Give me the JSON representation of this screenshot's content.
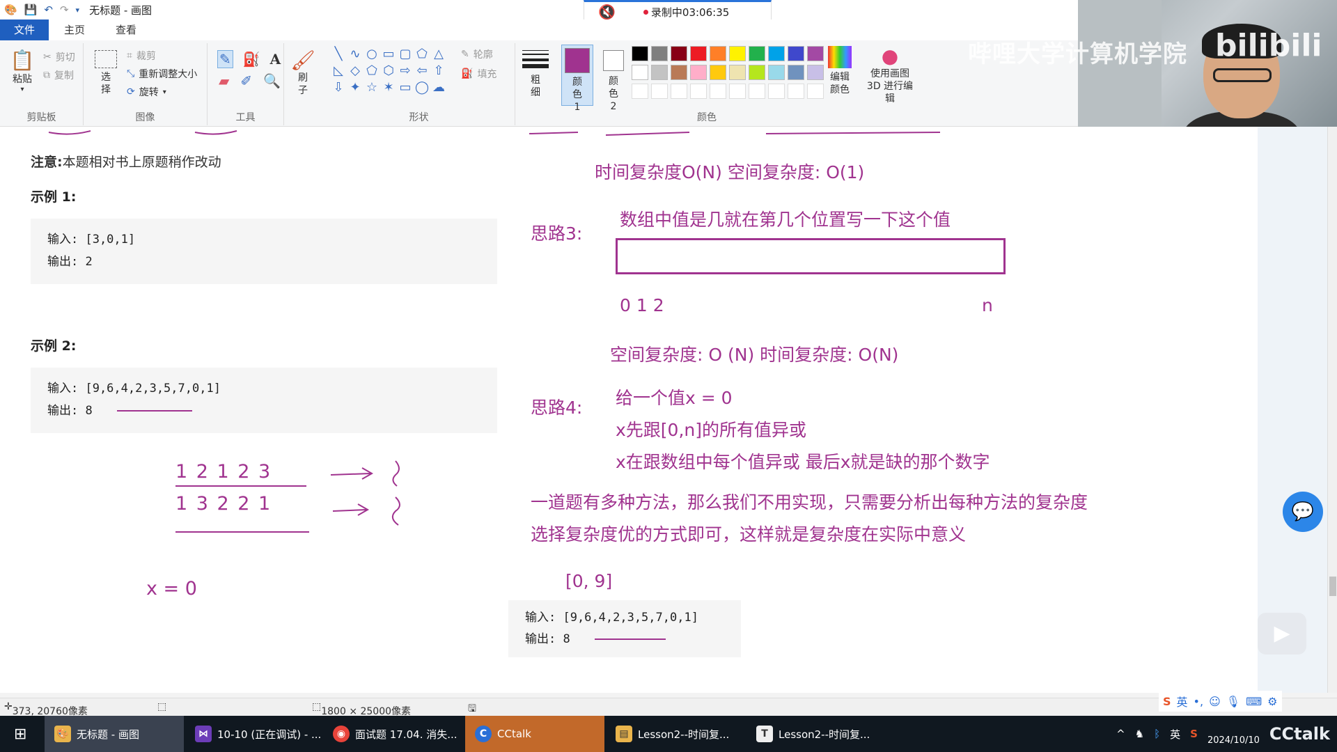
{
  "window": {
    "title": "无标题 - 画图",
    "recording_label": "录制中03:06:35"
  },
  "tabs": [
    "文件",
    "主页",
    "查看"
  ],
  "ribbon": {
    "clipboard": {
      "paste": "粘贴",
      "cut": "剪切",
      "copy": "复制",
      "label": "剪贴板"
    },
    "image": {
      "select": "选择",
      "crop": "裁剪",
      "resize": "重新调整大小",
      "rotate": "旋转",
      "label": "图像"
    },
    "tools": {
      "label": "工具"
    },
    "brushes": {
      "label": "刷子"
    },
    "shapes": {
      "outline": "轮廓",
      "fill": "填充",
      "label": "形状"
    },
    "size": {
      "label": "粗细"
    },
    "color1": "颜色 1",
    "color2": "颜色 2",
    "colors_label": "颜色",
    "edit_colors": "编辑颜色",
    "paint3d": "使用画图 3D 进行编辑",
    "color1_hex": "#a0338f",
    "palette": [
      "#000000",
      "#7f7f7f",
      "#880015",
      "#ed1c24",
      "#ff7f27",
      "#fff200",
      "#22b14c",
      "#00a2e8",
      "#3f48cc",
      "#a349a4",
      "#ffffff",
      "#c3c3c3",
      "#b97a57",
      "#ffaec9",
      "#ffc90e",
      "#efe4b0",
      "#b5e61d",
      "#99d9ea",
      "#7092be",
      "#c8bfe7",
      "#ffffff",
      "#ffffff",
      "#ffffff",
      "#ffffff",
      "#ffffff",
      "#ffffff",
      "#ffffff",
      "#ffffff",
      "#ffffff",
      "#ffffff"
    ]
  },
  "webcam": {
    "watermark": "哔哩大学计算机学院"
  },
  "doc": {
    "note_label": "注意:",
    "note_text": "本题相对书上原题稍作改动",
    "example1_label": "示例 1:",
    "example1_input": "输入: [3,0,1]",
    "example1_output": "输出: 2",
    "example2_label": "示例 2:",
    "example2_input": "输入: [9,6,4,2,3,5,7,0,1]",
    "example2_output": "输出: 8",
    "example3_input": "输入: [9,6,4,2,3,5,7,0,1]",
    "example3_output": "输出: 8"
  },
  "handwriting": {
    "complexity1": "时间复杂度O(N)      空间复杂度: O(1)",
    "idea3_label": "思路3:",
    "idea3_text": "数组中值是几就在第几个位置写一下这个值",
    "indices": "0   1   2",
    "n_label": "n",
    "complexity3": "空间复杂度: O (N)     时间复杂度: O(N)",
    "idea4_label": "思路4:",
    "idea4_line1": "给一个值x = 0",
    "idea4_line2": "x先跟[0,n]的所有值异或",
    "idea4_line3": "x在跟数组中每个值异或     最后x就是缺的那个数字",
    "summary_line1": "一道题有多种方法，那么我们不用实现，只需要分析出每种方法的复杂度",
    "summary_line2": "选择复杂度优的方式即可，这样就是复杂度在实际中意义",
    "range": "[0, 9]",
    "row1": "1  2  1  2  3",
    "row2": "1  3  2  2  1",
    "x_eq": "x = 0"
  },
  "status": {
    "cursor": "373, 20760像素",
    "canvas_size": "1800 × 25000像素"
  },
  "taskbar": {
    "items": [
      "无标题 - 画图",
      "10-10 (正在调试) - ...",
      "面试题 17.04. 消失...",
      "CCtalk",
      "Lesson2--时间复...",
      "Lesson2--时间复..."
    ],
    "ime": "英",
    "date": "2024/10/10",
    "cctalk_brand": "CCtalk"
  },
  "icons": [
    "save-icon",
    "undo-icon",
    "redo-icon",
    "paste-icon",
    "cut-icon",
    "copy-icon",
    "crop-icon",
    "resize-icon",
    "rotate-icon",
    "pencil-icon",
    "fill-icon",
    "text-icon",
    "eraser-icon",
    "color-picker-icon",
    "magnifier-icon",
    "brush-icon",
    "windows-start-icon",
    "chat-icon",
    "play-icon",
    "mute-icon"
  ]
}
